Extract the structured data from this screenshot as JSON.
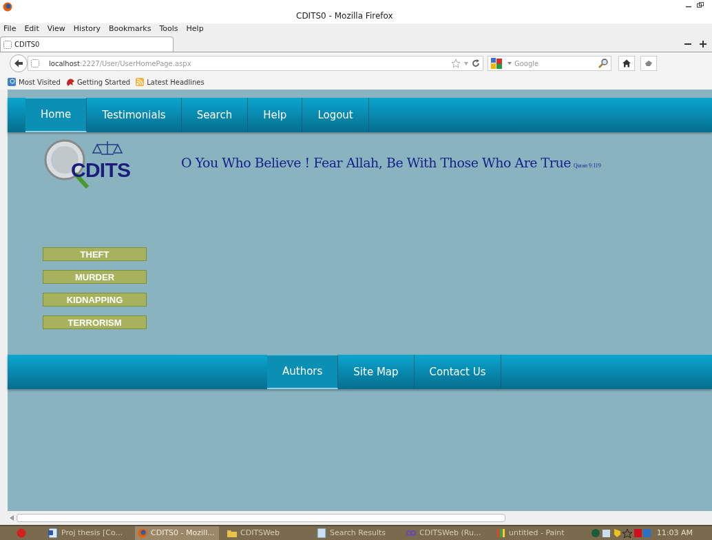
{
  "window": {
    "title": "CDITS0 - Mozilla Firefox"
  },
  "menu": [
    "File",
    "Edit",
    "View",
    "History",
    "Bookmarks",
    "Tools",
    "Help"
  ],
  "tabs": [
    {
      "label": "CDITS0",
      "selected": true
    }
  ],
  "address": {
    "host": "localhost",
    "path": ":2227/User/UserHomePage.aspx"
  },
  "search": {
    "placeholder": "Google"
  },
  "bookmarks": [
    {
      "label": "Most Visited"
    },
    {
      "label": "Getting Started"
    },
    {
      "label": "Latest Headlines"
    }
  ],
  "site_nav": [
    {
      "label": "Home",
      "selected": true
    },
    {
      "label": "Testimonials",
      "selected": false
    },
    {
      "label": "Search",
      "selected": false
    },
    {
      "label": "Help",
      "selected": false
    },
    {
      "label": "Logout",
      "selected": false
    }
  ],
  "logo": {
    "text": "CDITS"
  },
  "quote": {
    "text": "O You Who Believe ! Fear Allah, Be With Those Who Are True",
    "source": "Quran 9:119"
  },
  "categories": [
    "THEFT",
    "MURDER",
    "KIDNAPPING",
    "TERRORISM"
  ],
  "footer_nav": [
    {
      "label": "Authors",
      "selected": true
    },
    {
      "label": "Site Map",
      "selected": false
    },
    {
      "label": "Contact Us",
      "selected": false
    }
  ],
  "taskbar": [
    {
      "label": "Proj thesis [Co...",
      "selected": false
    },
    {
      "label": "CDITS0 - Mozill...",
      "selected": true
    },
    {
      "label": "CDITSWeb",
      "selected": false
    },
    {
      "label": "Search Results",
      "selected": false
    },
    {
      "label": "CDITSWeb (Ru...",
      "selected": false
    },
    {
      "label": "untitled - Paint",
      "selected": false
    }
  ],
  "clock": "11:03 AM"
}
